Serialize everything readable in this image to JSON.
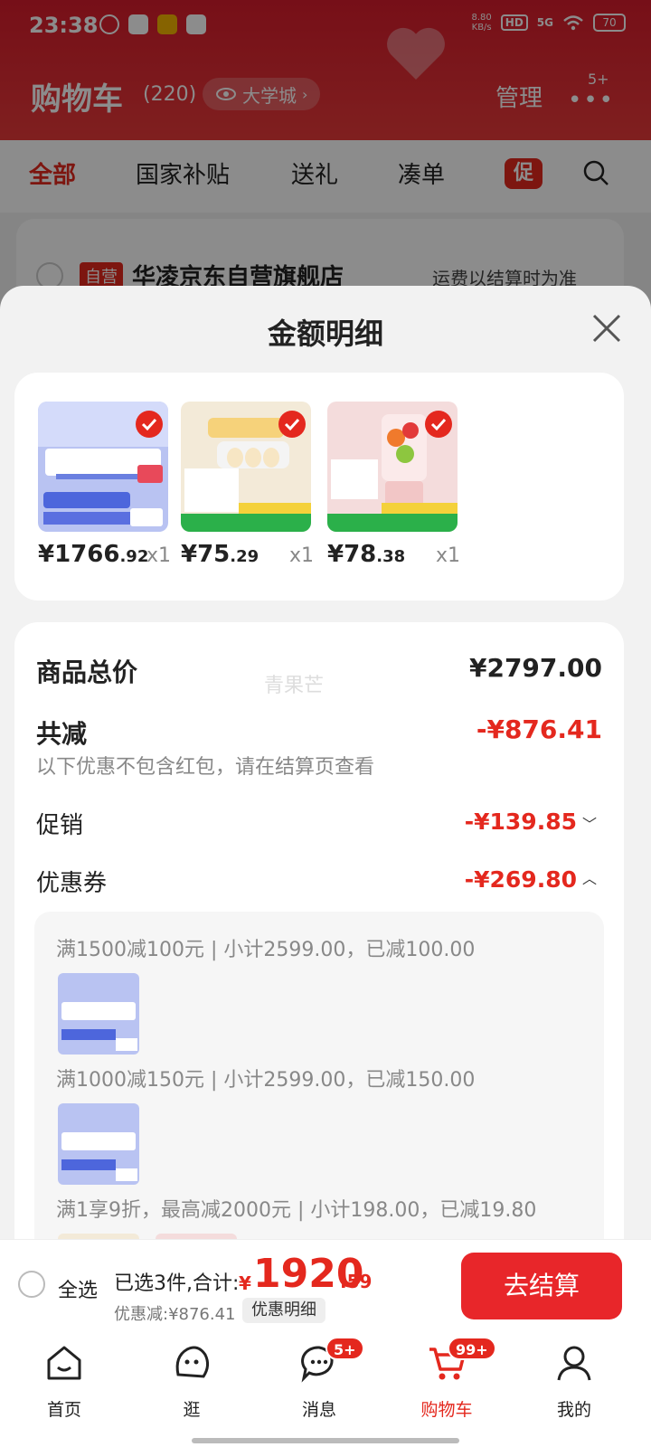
{
  "status_bar": {
    "time": "23:38",
    "net_speed": "8.80",
    "net_unit": "KB/s",
    "hd": "HD",
    "signal": "5G",
    "battery": "70"
  },
  "header": {
    "title": "购物车",
    "count": "(220)",
    "location": "大学城",
    "manage": "管理",
    "more_badge": "5+"
  },
  "tabs": [
    {
      "label": "全部"
    },
    {
      "label": "国家补贴"
    },
    {
      "label": "送礼"
    },
    {
      "label": "凑单"
    }
  ],
  "promo_tag": "促",
  "store": {
    "tag": "自营",
    "name": "华凌京东自营旗舰店",
    "shipping_note": "运费以结算时为准"
  },
  "sheet": {
    "title": "金额明细",
    "products": [
      {
        "price_int": "¥1766",
        "price_dec": ".92",
        "qty": "x1"
      },
      {
        "price_int": "¥75",
        "price_dec": ".29",
        "qty": "x1"
      },
      {
        "price_int": "¥78",
        "price_dec": ".38",
        "qty": "x1"
      }
    ],
    "total_label": "商品总价",
    "total_value": "¥2797.00",
    "watermark": "青果芒",
    "reduce_label": "共减",
    "reduce_value": "-¥876.41",
    "reduce_note": "以下优惠不包含红包，请在结算页查看",
    "promo_label": "促销",
    "promo_value": "-¥139.85",
    "coupon_label": "优惠券",
    "coupon_value": "-¥269.80",
    "coupons": [
      "满1500减100元 | 小计2599.00，已减100.00",
      "满1000减150元 | 小计2599.00，已减150.00",
      "满1享9折，最高减2000元 | 小计198.00，已减19.80"
    ]
  },
  "checkout": {
    "select_all": "全选",
    "selected_text": "已选3件,合计:",
    "currency": "¥",
    "total_int": "1920",
    "total_dec": ".59",
    "discount_note": "优惠减:¥876.41",
    "detail_button": "优惠明细",
    "checkout_button": "去结算"
  },
  "tabbar": [
    {
      "label": "首页"
    },
    {
      "label": "逛"
    },
    {
      "label": "消息",
      "badge": "5+"
    },
    {
      "label": "购物车",
      "badge": "99+"
    },
    {
      "label": "我的"
    }
  ],
  "colors": {
    "accent": "#e4281e",
    "header": "#d81c2c"
  }
}
